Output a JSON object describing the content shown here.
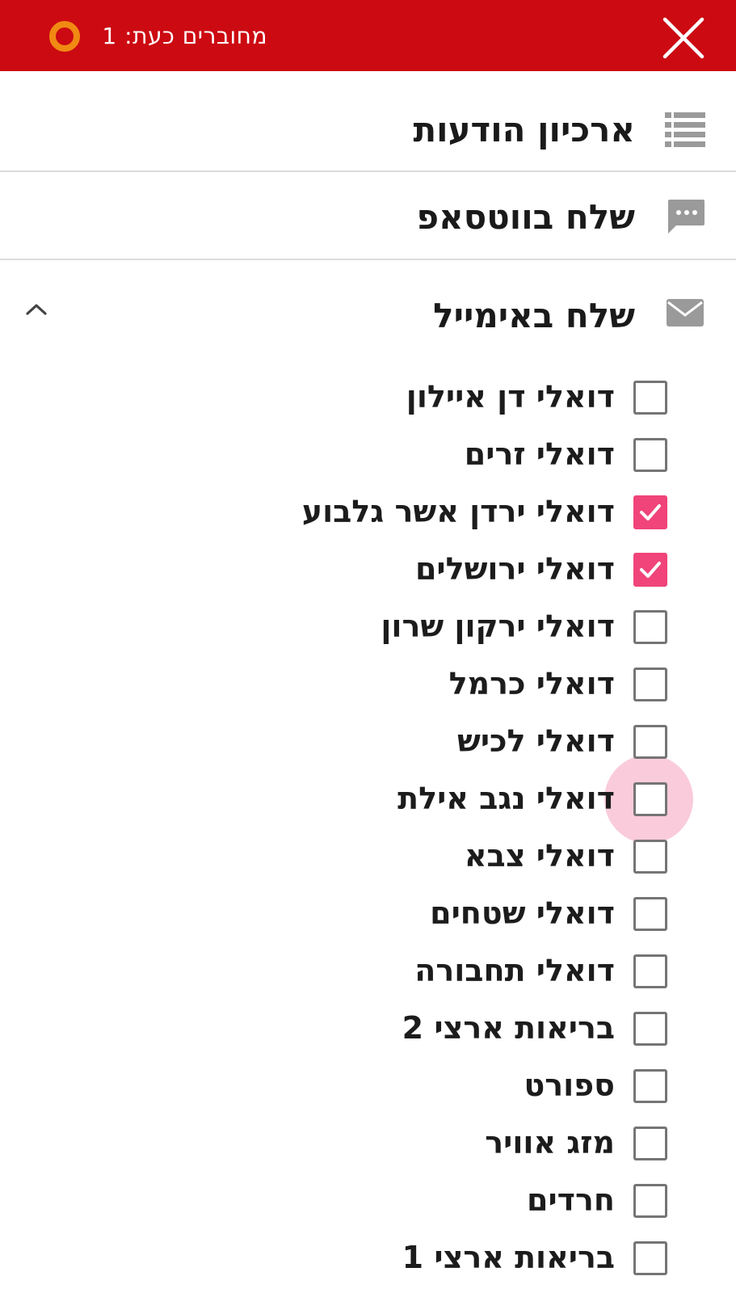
{
  "header": {
    "status_text": "מחוברים כעת: 1",
    "close_icon": "close-icon",
    "status_icon": "status-ring-icon",
    "bg_color": "#cc0a12",
    "status_color": "#f08a12"
  },
  "menu": {
    "archive_label": "ארכיון הודעות",
    "whatsapp_label": "שלח בווטסאפ",
    "email_label": "שלח באימייל"
  },
  "email_lists": [
    {
      "label": "דואלי דן איילון",
      "checked": false
    },
    {
      "label": "דואלי זרים",
      "checked": false
    },
    {
      "label": "דואלי ירדן אשר גלבוע",
      "checked": true
    },
    {
      "label": "דואלי ירושלים",
      "checked": true
    },
    {
      "label": "דואלי ירקון שרון",
      "checked": false
    },
    {
      "label": "דואלי כרמל",
      "checked": false
    },
    {
      "label": "דואלי לכיש",
      "checked": false
    },
    {
      "label": "דואלי נגב אילת",
      "checked": false
    },
    {
      "label": "דואלי צבא",
      "checked": false
    },
    {
      "label": "דואלי שטחים",
      "checked": false
    },
    {
      "label": "דואלי תחבורה",
      "checked": false
    },
    {
      "label": "בריאות ארצי 2",
      "checked": false
    },
    {
      "label": "ספורט",
      "checked": false
    },
    {
      "label": "מזג אוויר",
      "checked": false
    },
    {
      "label": "חרדים",
      "checked": false
    },
    {
      "label": "בריאות ארצי 1",
      "checked": false
    }
  ],
  "accent_color": "#f0447a"
}
